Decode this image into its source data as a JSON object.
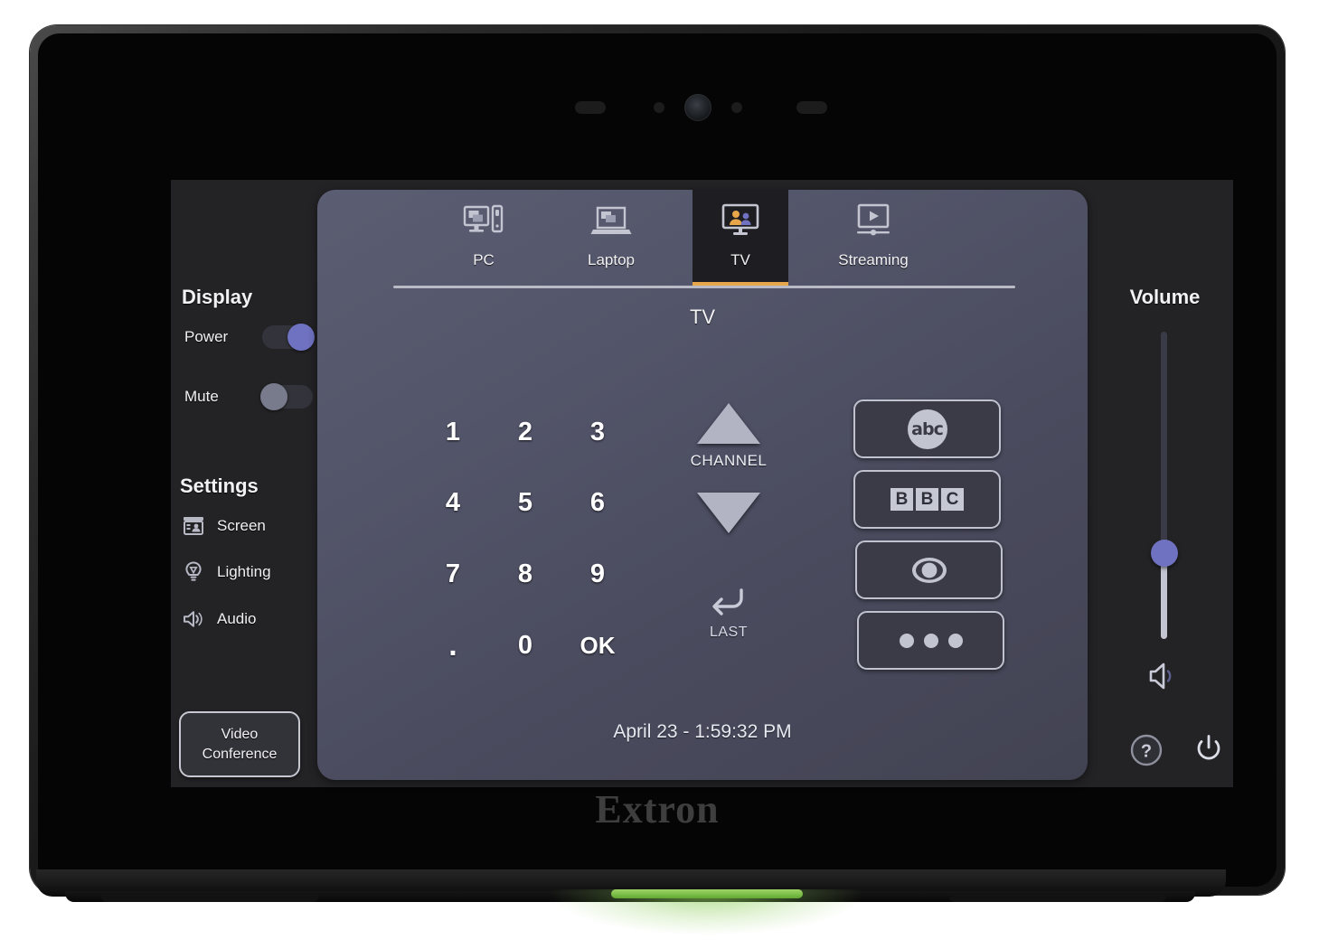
{
  "device": {
    "brand": "Extron",
    "status_led_color": "#79bd47",
    "bezel_color": "#141414"
  },
  "theme": {
    "panel_gradient_from": "#5b5d72",
    "panel_gradient_to": "#424352",
    "screen_bg": "#232326",
    "accent": "#6f72c0",
    "active_tab_underline": "#e8a64a",
    "text_primary": "#f2f2f4"
  },
  "sidebar": {
    "display_heading": "Display",
    "toggles": [
      {
        "label": "Power",
        "state": "on"
      },
      {
        "label": "Mute",
        "state": "off"
      }
    ],
    "settings_heading": "Settings",
    "settings": [
      {
        "label": "Screen",
        "icon": "screen-icon"
      },
      {
        "label": "Lighting",
        "icon": "lightbulb-icon"
      },
      {
        "label": "Audio",
        "icon": "speaker-icon"
      }
    ],
    "video_conference": {
      "line1": "Video",
      "line2": "Conference"
    }
  },
  "panel": {
    "tabs": [
      {
        "label": "PC",
        "icon": "desktop-pc-icon",
        "active": false
      },
      {
        "label": "Laptop",
        "icon": "laptop-icon",
        "active": false
      },
      {
        "label": "TV",
        "icon": "tv-people-icon",
        "active": true
      },
      {
        "label": "Streaming",
        "icon": "media-play-icon",
        "active": false
      }
    ],
    "title": "TV",
    "keypad": [
      {
        "label": "1"
      },
      {
        "label": "2"
      },
      {
        "label": "3"
      },
      {
        "label": "4"
      },
      {
        "label": "5"
      },
      {
        "label": "6"
      },
      {
        "label": "7"
      },
      {
        "label": "8"
      },
      {
        "label": "9"
      },
      {
        "label": "."
      },
      {
        "label": "0"
      },
      {
        "label": "OK"
      }
    ],
    "channel": {
      "label": "CHANNEL",
      "up_icon": "triangle-up-icon",
      "down_icon": "triangle-down-icon",
      "last_label": "LAST",
      "last_icon": "return-arrow-icon"
    },
    "presets": [
      {
        "name": "abc",
        "icon": "abc-logo-icon"
      },
      {
        "name": "BBC",
        "icon": "bbc-logo-icon",
        "letters": [
          "B",
          "B",
          "C"
        ]
      },
      {
        "name": "CBS",
        "icon": "cbs-eye-icon"
      },
      {
        "name": "More",
        "icon": "ellipsis-icon"
      }
    ],
    "clock": "April 23 - 1:59:32 PM"
  },
  "rail": {
    "heading": "Volume",
    "slider": {
      "orientation": "vertical",
      "thumb_position_pct": 68
    },
    "speaker_icon": "speaker-wave-icon",
    "buttons": [
      {
        "name": "help",
        "icon": "question-circle-icon"
      },
      {
        "name": "power",
        "icon": "power-icon"
      }
    ]
  }
}
